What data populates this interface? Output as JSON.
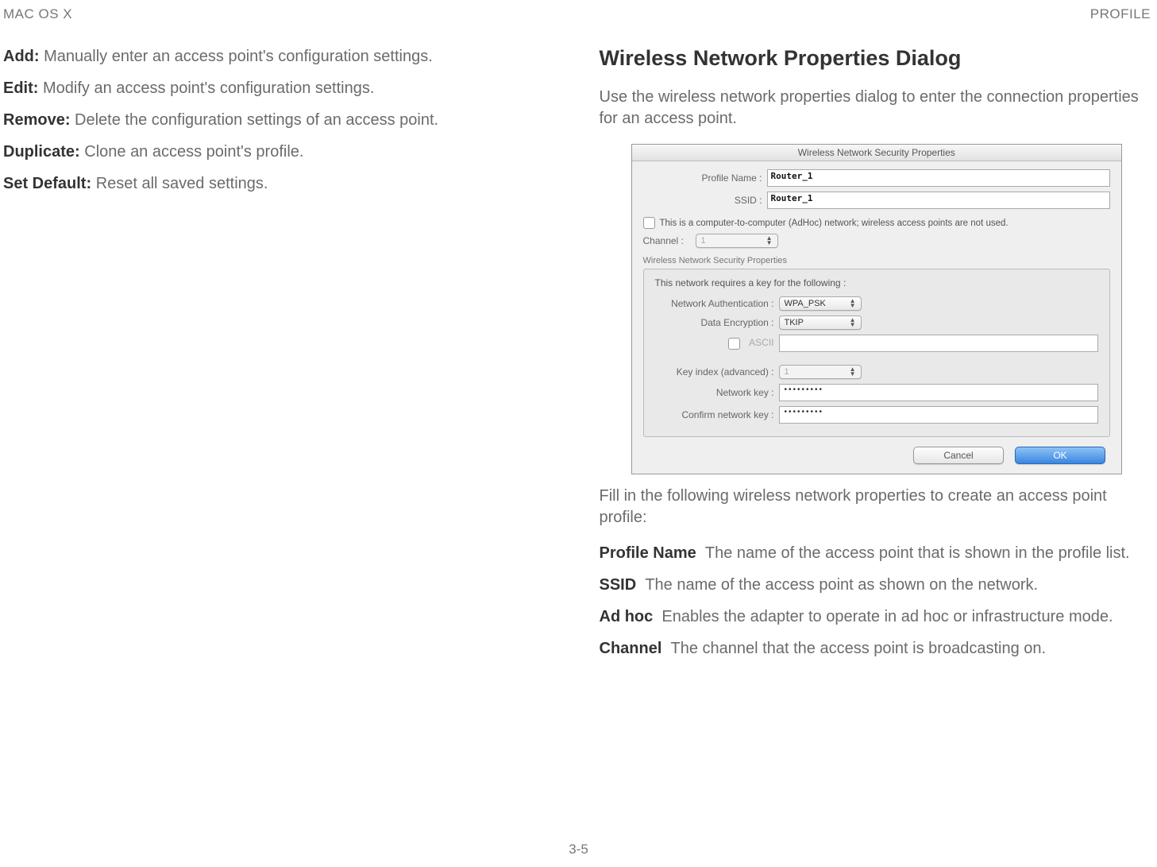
{
  "header": {
    "left": "MAC OS X",
    "right": "PROFILE"
  },
  "left_col": {
    "defs": [
      {
        "term": "Add:",
        "desc": "Manually enter an access point's configuration settings."
      },
      {
        "term": "Edit:",
        "desc": "Modify an access point's configuration settings."
      },
      {
        "term": "Remove:",
        "desc": "Delete the configuration settings of an access point."
      },
      {
        "term": "Duplicate:",
        "desc": "Clone an access point's profile."
      },
      {
        "term": "Set Default:",
        "desc": "Reset all saved settings."
      }
    ]
  },
  "right_col": {
    "heading": "Wireless Network Properties Dialog",
    "intro": "Use the wireless network properties dialog to enter the connection properties for an access point.",
    "after_img": "Fill in the following wireless network properties to create an access point profile:",
    "props": [
      {
        "term": "Profile Name",
        "desc": "The name of the access point that is shown in the profile list."
      },
      {
        "term": "SSID",
        "desc": "The name of the access point as shown on the network."
      },
      {
        "term": "Ad hoc",
        "desc": "Enables the adapter to operate in ad hoc or infrastructure mode."
      },
      {
        "term": "Channel",
        "desc": "The channel that the access point is broadcasting on."
      }
    ]
  },
  "dialog": {
    "title": "Wireless Network Security Properties",
    "profile_name_label": "Profile Name :",
    "profile_name_value": "Router_1",
    "ssid_label": "SSID :",
    "ssid_value": "Router_1",
    "adhoc_text": "This is a computer-to-computer (AdHoc) network; wireless access points are not used.",
    "channel_label": "Channel :",
    "channel_value": "1",
    "sec_header": "Wireless Network Security Properties",
    "panel_msg": "This network requires a key for the following :",
    "auth_label": "Network Authentication :",
    "auth_value": "WPA_PSK",
    "enc_label": "Data Encryption :",
    "enc_value": "TKIP",
    "ascii_label": "ASCII",
    "key_index_label": "Key index (advanced) :",
    "key_index_value": "1",
    "net_key_label": "Network key :",
    "net_key_value": "•••••••••",
    "confirm_label": "Confirm network key :",
    "confirm_value": "•••••••••",
    "cancel": "Cancel",
    "ok": "OK"
  },
  "footer": "3-5"
}
